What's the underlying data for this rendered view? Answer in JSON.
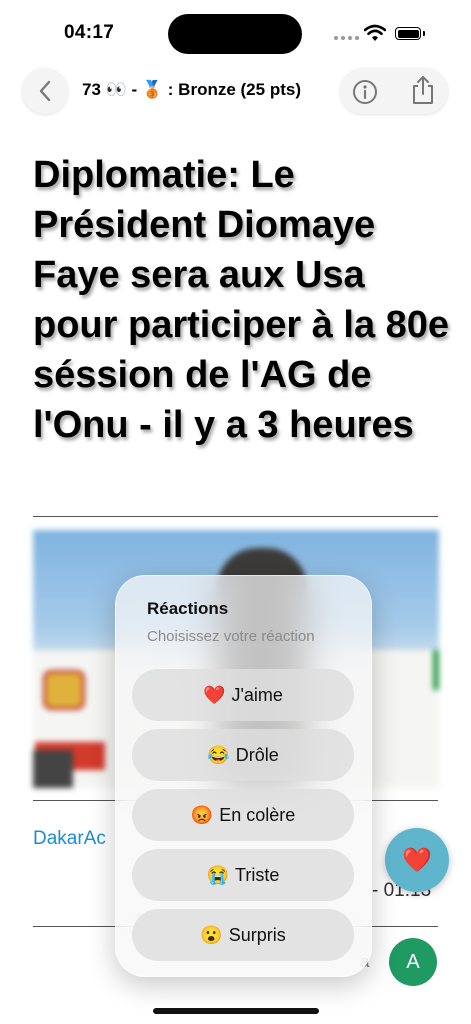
{
  "status_bar": {
    "time": "04:17"
  },
  "nav": {
    "title": "73 👀 - 🥉 : Bronze (25 pts)"
  },
  "article": {
    "headline": "Diplomatie: Le Président Diomaye Faye sera aux Usa pour participer à la 80e séssion de l'AG de l'Onu - il y a 3 heures",
    "source": "DakarAc",
    "date": "- 01:13",
    "trailing_text": "a",
    "avatar_initial": "A"
  },
  "reactions": {
    "title": "Réactions",
    "subtitle": "Choisissez votre réaction",
    "items": [
      {
        "emoji": "❤️",
        "label": "J'aime"
      },
      {
        "emoji": "😂",
        "label": "Drôle"
      },
      {
        "emoji": "😡",
        "label": "En colère"
      },
      {
        "emoji": "😭",
        "label": "Triste"
      },
      {
        "emoji": "😮",
        "label": "Surpris"
      }
    ]
  },
  "fab": {
    "emoji": "❤️"
  }
}
